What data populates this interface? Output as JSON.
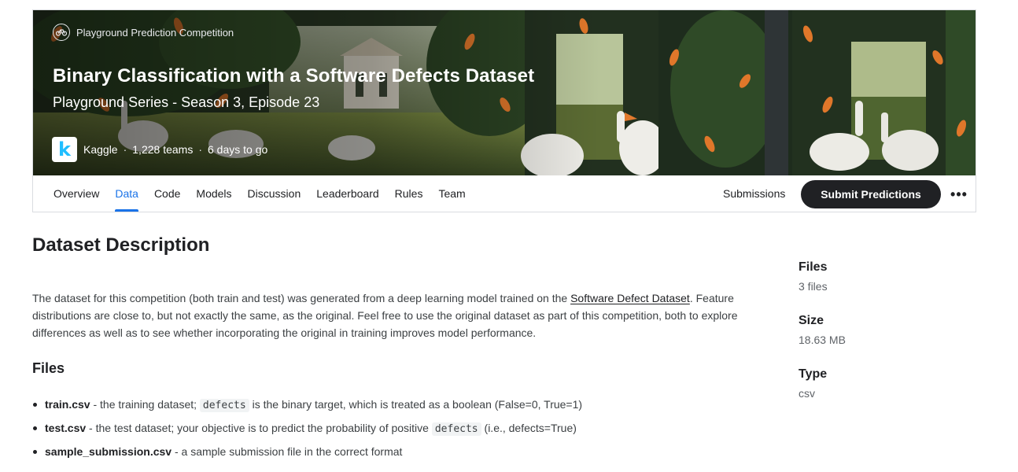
{
  "banner": {
    "competition_type": "Playground Prediction Competition",
    "competition_type_icon": "bicycle-icon",
    "title": "Binary Classification with a Software Defects Dataset",
    "subtitle": "Playground Series - Season 3, Episode 23",
    "host_logo_letter": "k",
    "host": "Kaggle",
    "teams": "1,228 teams",
    "deadline": "6 days to go",
    "separator": "·"
  },
  "nav": {
    "tabs": [
      {
        "label": "Overview",
        "active": false
      },
      {
        "label": "Data",
        "active": true
      },
      {
        "label": "Code",
        "active": false
      },
      {
        "label": "Models",
        "active": false
      },
      {
        "label": "Discussion",
        "active": false
      },
      {
        "label": "Leaderboard",
        "active": false
      },
      {
        "label": "Rules",
        "active": false
      },
      {
        "label": "Team",
        "active": false
      }
    ],
    "submissions_label": "Submissions",
    "submit_label": "Submit Predictions",
    "more_icon": "more-horizontal-icon",
    "more_glyph": "•••"
  },
  "main": {
    "title": "Dataset Description",
    "para_before_link": "The dataset for this competition (both train and test) was generated from a deep learning model trained on the ",
    "para_link": "Software Defect Dataset",
    "para_after_link": ". Feature distributions are close to, but not exactly the same, as the original. Feel free to use the original dataset as part of this competition, both to explore differences as well as to see whether incorporating the original in training improves model performance.",
    "files_title": "Files",
    "files": [
      {
        "name": "train.csv",
        "before_code": " - the training dataset; ",
        "code": "defects",
        "after_code": " is the binary target, which is treated as a boolean (False=0, True=1)"
      },
      {
        "name": "test.csv",
        "before_code": " - the test dataset; your objective is to predict the probability of positive ",
        "code": "defects",
        "after_code": " (i.e., defects=True)"
      },
      {
        "name": "sample_submission.csv",
        "before_code": " - a sample submission file in the correct format",
        "code": "",
        "after_code": ""
      }
    ]
  },
  "sidebar": {
    "files_label": "Files",
    "files_value": "3 files",
    "size_label": "Size",
    "size_value": "18.63 MB",
    "type_label": "Type",
    "type_value": "csv"
  },
  "colors": {
    "accent": "#1a73e8",
    "button": "#202124",
    "kaggle_blue": "#20beff"
  }
}
